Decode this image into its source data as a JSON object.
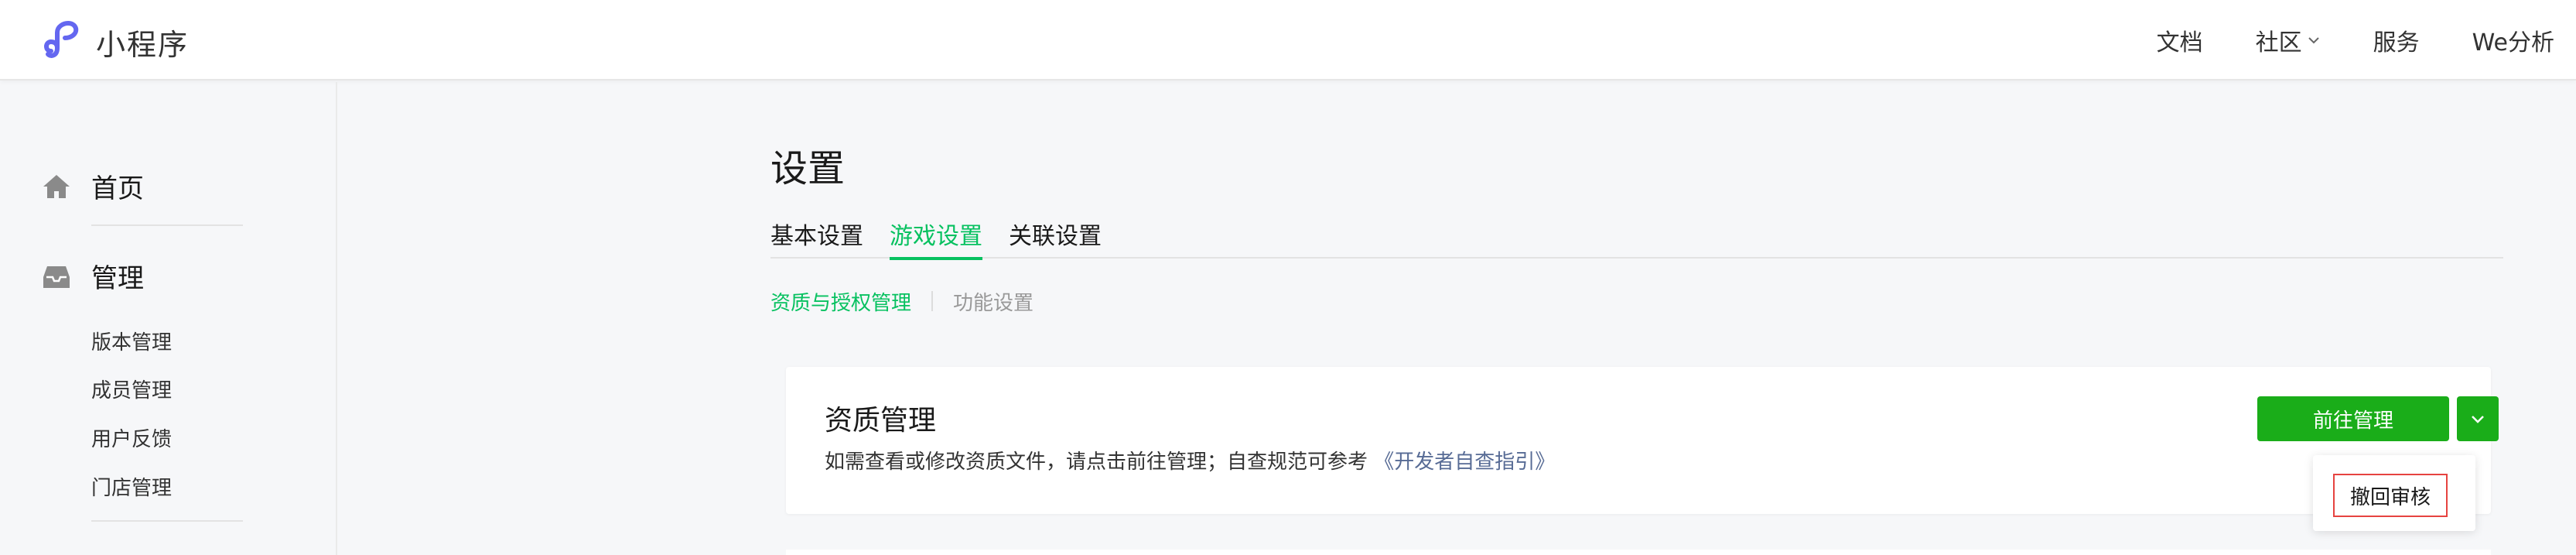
{
  "header": {
    "logo_text": "小程序",
    "nav": [
      {
        "label": "文档",
        "dropdown": false
      },
      {
        "label": "社区",
        "dropdown": true
      },
      {
        "label": "服务",
        "dropdown": false
      },
      {
        "label": "We分析",
        "dropdown": false
      }
    ]
  },
  "sidebar": {
    "home_label": "首页",
    "manage_label": "管理",
    "manage_items": [
      "版本管理",
      "成员管理",
      "用户反馈",
      "门店管理"
    ]
  },
  "main": {
    "title": "设置",
    "tabs": [
      {
        "label": "基本设置",
        "active": false
      },
      {
        "label": "游戏设置",
        "active": true
      },
      {
        "label": "关联设置",
        "active": false
      }
    ],
    "subtabs": [
      {
        "label": "资质与授权管理",
        "active": true
      },
      {
        "label": "功能设置",
        "active": false
      }
    ],
    "card": {
      "title": "资质管理",
      "desc": "如需查看或修改资质文件，请点击前往管理；自查规范可参考",
      "link": "《开发者自查指引》",
      "primary_button": "前往管理",
      "dropdown_item": "撤回审核"
    }
  },
  "colors": {
    "accent_green": "#07c160",
    "button_green": "#1aad19",
    "link_blue": "#576b95",
    "logo_purple": "#6467f0",
    "danger_red": "#e64340"
  }
}
